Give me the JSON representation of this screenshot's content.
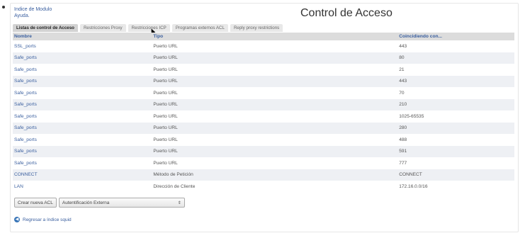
{
  "header": {
    "links": [
      "Indice de Modulo",
      "Ayuda."
    ],
    "title": "Control de Acceso"
  },
  "tabs": [
    {
      "label": "Listas de control de Acceso",
      "active": true
    },
    {
      "label": "Restricciones Proxy",
      "active": false
    },
    {
      "label": "Restricciones ICP",
      "active": false
    },
    {
      "label": "Programas externos ACL",
      "active": false
    },
    {
      "label": "Reply proxy restrictions",
      "active": false
    }
  ],
  "table": {
    "headers": [
      "Nombre",
      "Tipo",
      "Coincidiendo con..."
    ],
    "rows": [
      {
        "name": "SSL_ports",
        "type": "Puerto URL",
        "match": "443"
      },
      {
        "name": "Safe_ports",
        "type": "Puerto URL",
        "match": "80"
      },
      {
        "name": "Safe_ports",
        "type": "Puerto URL",
        "match": "21"
      },
      {
        "name": "Safe_ports",
        "type": "Puerto URL",
        "match": "443"
      },
      {
        "name": "Safe_ports",
        "type": "Puerto URL",
        "match": "70"
      },
      {
        "name": "Safe_ports",
        "type": "Puerto URL",
        "match": "210"
      },
      {
        "name": "Safe_ports",
        "type": "Puerto URL",
        "match": "1025-65535"
      },
      {
        "name": "Safe_ports",
        "type": "Puerto URL",
        "match": "280"
      },
      {
        "name": "Safe_ports",
        "type": "Puerto URL",
        "match": "488"
      },
      {
        "name": "Safe_ports",
        "type": "Puerto URL",
        "match": "591"
      },
      {
        "name": "Safe_ports",
        "type": "Puerto URL",
        "match": "777"
      },
      {
        "name": "CONNECT",
        "type": "Método de Petición",
        "match": "CONNECT"
      },
      {
        "name": "LAN",
        "type": "Dirección de Cliente",
        "match": "172.16.0.0/16"
      }
    ]
  },
  "actions": {
    "create_button": "Crear nueva ACL",
    "select_value": "Autentificación Externa",
    "select_arrows": "⇕"
  },
  "footer": {
    "back_link": "Regresar a índice squid",
    "back_icon": "arrow-left-icon"
  },
  "colors": {
    "link": "#3a5f9f",
    "header_bg": "#dcdcdc",
    "row_alt": "#eef0f4"
  }
}
